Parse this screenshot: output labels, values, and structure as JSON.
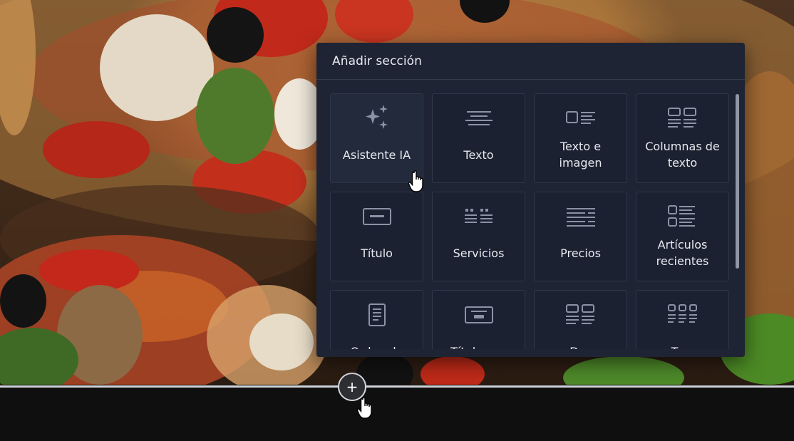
{
  "panel": {
    "title": "Añadir sección",
    "tiles": [
      {
        "label": "Asistente IA",
        "icon": "sparkles-icon",
        "hovered": true
      },
      {
        "label": "Texto",
        "icon": "text-lines-icon"
      },
      {
        "label": "Texto e imagen",
        "icon": "text-image-icon"
      },
      {
        "label": "Columnas de texto",
        "icon": "text-columns-icon"
      },
      {
        "label": "Título",
        "icon": "title-block-icon"
      },
      {
        "label": "Servicios",
        "icon": "services-icon"
      },
      {
        "label": "Precios",
        "icon": "pricing-icon"
      },
      {
        "label": "Artículos recientes",
        "icon": "recent-articles-icon"
      },
      {
        "label": "Orden de",
        "icon": "document-list-icon"
      },
      {
        "label": "Título con",
        "icon": "title-button-icon"
      },
      {
        "label": "Dos",
        "icon": "two-columns-icon"
      },
      {
        "label": "Tres",
        "icon": "three-columns-icon"
      }
    ]
  },
  "add_section_button": {
    "label": "+",
    "icon": "plus-icon"
  },
  "colors": {
    "panel_bg": "#1e2433",
    "tile_bg": "#1b2130",
    "tile_border": "#2f374a",
    "icon": "#8b93a6",
    "text": "#e6e9ef"
  }
}
